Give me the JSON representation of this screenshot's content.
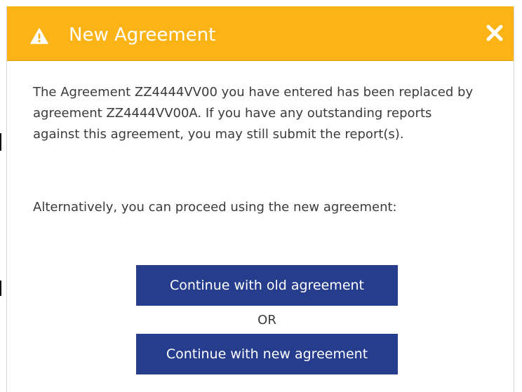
{
  "dialog": {
    "title": "New Agreement",
    "header_color": "#fcb316",
    "header_icon": "warning-triangle-icon",
    "close_icon": "close-x-icon"
  },
  "message": {
    "paragraph1": "The Agreement ZZ4444VV00 you have entered has been replaced by agreement ZZ4444VV00A. If you have any outstanding reports against this agreement, you may still submit the report(s).",
    "paragraph2": "Alternatively, you can proceed using the new agreement:"
  },
  "actions": {
    "old_label": "Continue with old agreement",
    "or_label": "OR",
    "new_label": "Continue with new agreement",
    "button_color": "#253d8c"
  }
}
